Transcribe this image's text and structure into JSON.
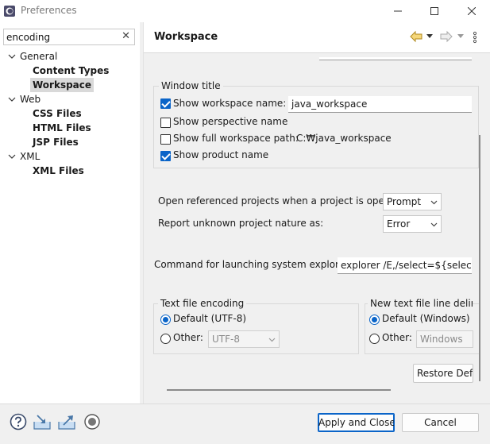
{
  "window": {
    "title": "Preferences",
    "controls": [
      "minimize",
      "maximize",
      "close"
    ]
  },
  "filter": {
    "value": "encoding"
  },
  "tree": [
    {
      "label": "General",
      "expanded": true,
      "children": [
        "Content Types",
        "Workspace"
      ]
    },
    {
      "label": "Web",
      "expanded": true,
      "children": [
        "CSS Files",
        "HTML Files",
        "JSP Files"
      ]
    },
    {
      "label": "XML",
      "expanded": true,
      "children": [
        "XML Files"
      ]
    }
  ],
  "selected_item": "Workspace",
  "page": {
    "title": "Workspace"
  },
  "window_title_group": {
    "label": "Window title",
    "show_workspace_name": {
      "label": "Show workspace name:",
      "checked": true,
      "value": "java_workspace"
    },
    "show_perspective_name": {
      "label": "Show perspective name",
      "checked": false
    },
    "show_full_path": {
      "label": "Show full workspace path:",
      "checked": false,
      "value": "C:₩java_workspace"
    },
    "show_product_name": {
      "label": "Show product name",
      "checked": true
    }
  },
  "open_referenced": {
    "label": "Open referenced projects when a project is opened:",
    "value": "Prompt"
  },
  "report_unknown": {
    "label": "Report unknown project nature as:",
    "value": "Error"
  },
  "system_explorer": {
    "label": "Command for launching system explorer:",
    "value": "explorer /E,/select=${selected_"
  },
  "text_encoding": {
    "label": "Text file encoding",
    "default_label": "Default (UTF-8)",
    "other_label": "Other:",
    "other_value": "UTF-8",
    "selected": "default"
  },
  "line_delimiter": {
    "label": "New text file line delimi",
    "default_label": "Default (Windows)",
    "other_label": "Other:",
    "other_value": "Windows",
    "selected": "default"
  },
  "restore_defaults": {
    "label": "Restore Defa"
  },
  "buttons": {
    "apply_close": "Apply and Close",
    "cancel": "Cancel"
  },
  "icons": [
    "help-icon",
    "import-icon",
    "export-icon",
    "record-icon",
    "back-icon",
    "forward-icon",
    "menu-icon"
  ],
  "colors": {
    "accent": "#0a64c8",
    "panel": "#f0f0f0",
    "white": "#ffffff"
  }
}
